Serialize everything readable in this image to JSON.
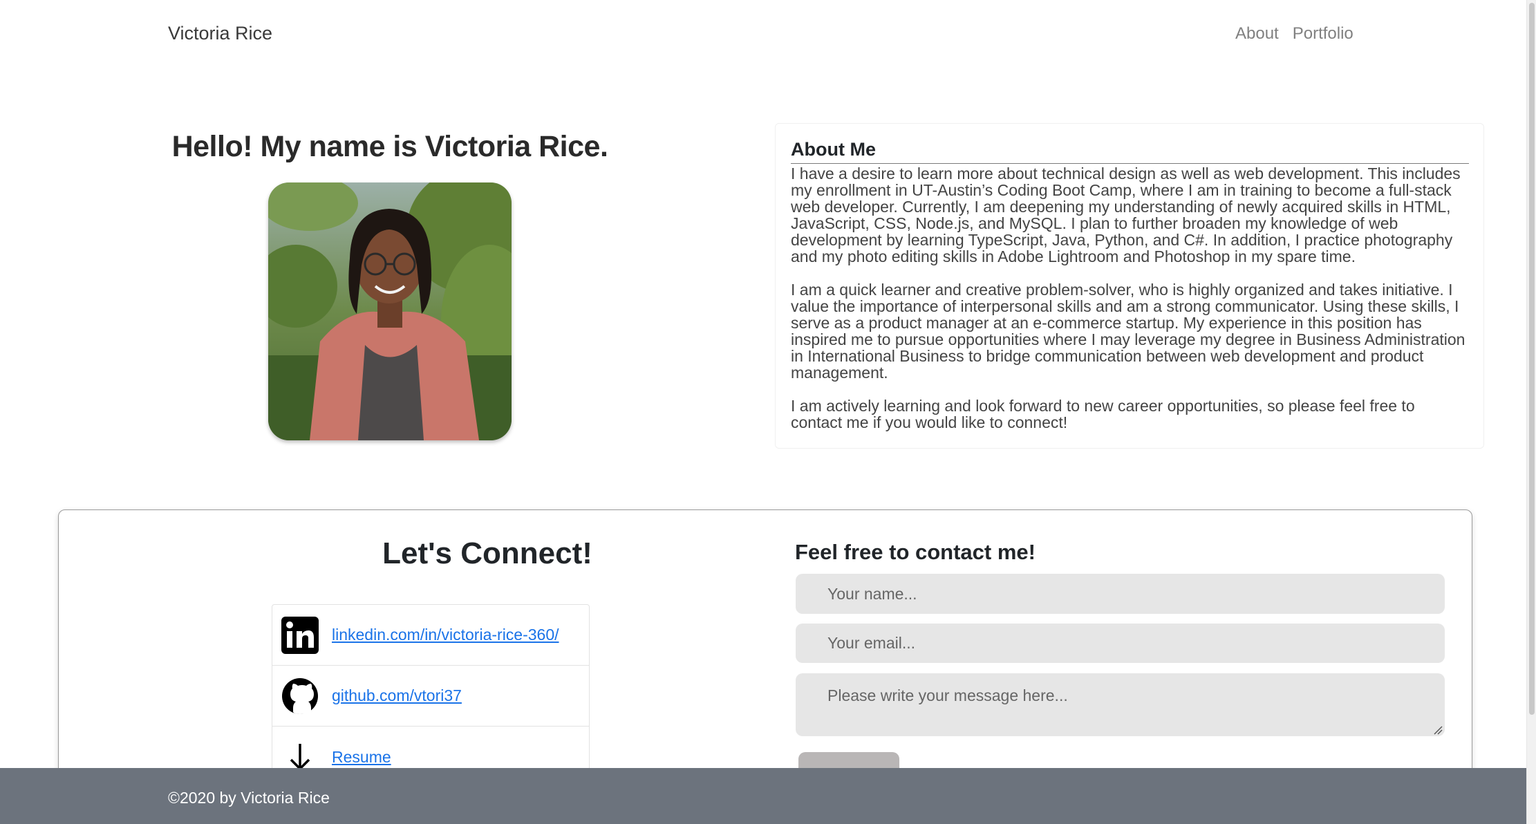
{
  "navbar": {
    "brand": "Victoria Rice",
    "links": [
      "About",
      "Portfolio"
    ]
  },
  "intro": {
    "heading": "Hello! My name is Victoria Rice."
  },
  "about": {
    "title": "About Me",
    "paragraphs": [
      "I have a desire to learn more about technical design as well as web development. This includes my enrollment in UT-Austin’s Coding Boot Camp, where I am in training to become a full-stack web developer. Currently, I am deepening my understanding of newly acquired skills in HTML, JavaScript, CSS, Node.js, and MySQL. I plan to further broaden my knowledge of web development by learning TypeScript, Java, Python, and C#. In addition, I practice photography and my photo editing skills in Adobe Lightroom and Photoshop in my spare time.",
      "I am a quick learner and creative problem-solver, who is highly organized and takes initiative. I value the importance of interpersonal skills and am a strong communicator. Using these skills, I serve as a product manager at an e-commerce startup. My experience in this position has inspired me to pursue opportunities where I may leverage my degree in Business Administration in International Business to bridge communication between web development and product management.",
      "I am actively learning and look forward to new career opportunities, so please feel free to contact me if you would like to connect!"
    ]
  },
  "connect": {
    "heading": "Let's Connect!",
    "links": [
      {
        "icon": "linkedin-icon",
        "label": "linkedin.com/in/victoria-rice-360/"
      },
      {
        "icon": "github-icon",
        "label": "github.com/vtori37"
      },
      {
        "icon": "download-arrow-icon",
        "label": "Resume"
      }
    ]
  },
  "contact_form": {
    "heading": "Feel free to contact me!",
    "name_placeholder": "Your name...",
    "email_placeholder": "Your email...",
    "message_placeholder": "Please write your message here..."
  },
  "footer": {
    "text": "©2020 by Victoria Rice"
  },
  "colors": {
    "footer_bg": "#6c737d",
    "link": "#1a73e8",
    "field_bg": "#e6e6e6"
  }
}
